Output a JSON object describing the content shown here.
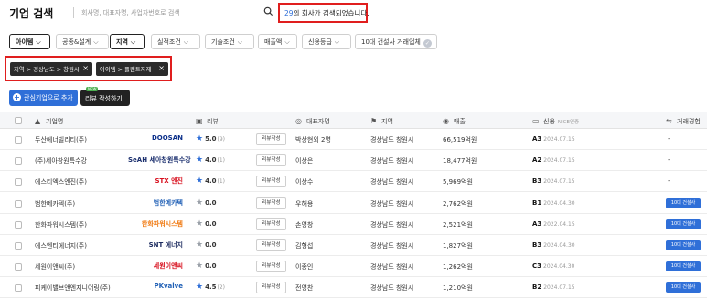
{
  "header": {
    "title": "기업 검색",
    "search_placeholder": "회사명, 대표자명, 사업자번호로 검색",
    "result_count": "29",
    "result_suffix": "의 회사가 검색되었습니다."
  },
  "filters": [
    {
      "label": "아이템",
      "active": true
    },
    {
      "label": "공종&설계",
      "active": false
    },
    {
      "label": "지역",
      "active": true
    },
    {
      "label": "실적조건",
      "active": false
    },
    {
      "label": "기술조건",
      "active": false
    },
    {
      "label": "매출액",
      "active": false
    },
    {
      "label": "신용등급",
      "active": false
    },
    {
      "label": "10대 건설사 거래업체",
      "active": false
    }
  ],
  "applied_tags": [
    {
      "label": "지역 > 경상남도 > 창원시"
    },
    {
      "label": "아이템 > 플랜트자재"
    }
  ],
  "actions": {
    "favorite_label": "관심기업으로 추가",
    "review_label": "리뷰 작성하기",
    "review_badge": "NEW"
  },
  "columns": {
    "company": "기업명",
    "review": "리뷰",
    "ceo": "대표자명",
    "region": "지역",
    "sales": "매출",
    "credit": "신용",
    "credit_sub": "NICE인증",
    "trade": "거래경험"
  },
  "rows": [
    {
      "name": "두산에너빌리티(주)",
      "logo": "DOOSAN",
      "logo_color": "#0b2f8a",
      "rating": "5.0",
      "review_count": "(9)",
      "rated": true,
      "review_btn": "리뷰작성",
      "ceo": "박상현외 2명",
      "region": "경상남도 창원시",
      "sales": "66,519억원",
      "grade": "A3",
      "grade_date": "2024.07.15",
      "trade": "-"
    },
    {
      "name": "(주)세아창원특수강",
      "logo": "SeAH 세아창원특수강",
      "logo_color": "#1b2f6e",
      "rating": "4.0",
      "review_count": "(1)",
      "rated": true,
      "review_btn": "리뷰작성",
      "ceo": "이상은",
      "region": "경상남도 창원시",
      "sales": "18,477억원",
      "grade": "A2",
      "grade_date": "2024.07.15",
      "trade": "-"
    },
    {
      "name": "에스티엑스엔진(주)",
      "logo": "STX 엔진",
      "logo_color": "#d8101e",
      "rating": "4.0",
      "review_count": "(1)",
      "rated": true,
      "review_btn": "리뷰작성",
      "ceo": "이상수",
      "region": "경상남도 창원시",
      "sales": "5,969억원",
      "grade": "B3",
      "grade_date": "2024.07.15",
      "trade": "-"
    },
    {
      "name": "범한메카텍(주)",
      "logo": "범한메카텍",
      "logo_color": "#1f5fb5",
      "rating": "0.0",
      "review_count": "",
      "rated": false,
      "review_btn": "리뷰작성",
      "ceo": "우해용",
      "region": "경상남도 창원시",
      "sales": "2,762억원",
      "grade": "B1",
      "grade_date": "2024.04.30",
      "trade": "10대 건설사"
    },
    {
      "name": "한화파워시스템(주)",
      "logo": "한화파워시스템",
      "logo_color": "#f07a12",
      "rating": "0.0",
      "review_count": "",
      "rated": false,
      "review_btn": "리뷰작성",
      "ceo": "손영창",
      "region": "경상남도 창원시",
      "sales": "2,521억원",
      "grade": "A3",
      "grade_date": "2022.04.15",
      "trade": "10대 건설사"
    },
    {
      "name": "에스엔티에너지(주)",
      "logo": "SNT 에너지",
      "logo_color": "#1b2a5e",
      "rating": "0.0",
      "review_count": "",
      "rated": false,
      "review_btn": "리뷰작성",
      "ceo": "김형섭",
      "region": "경상남도 창원시",
      "sales": "1,827억원",
      "grade": "B3",
      "grade_date": "2024.04.30",
      "trade": "10대 건설사"
    },
    {
      "name": "세원이앤씨(주)",
      "logo": "세원이앤씨",
      "logo_color": "#d8101e",
      "rating": "0.0",
      "review_count": "",
      "rated": false,
      "review_btn": "리뷰작성",
      "ceo": "이종인",
      "region": "경상남도 창원시",
      "sales": "1,262억원",
      "grade": "C3",
      "grade_date": "2024.04.30",
      "trade": "10대 건설사"
    },
    {
      "name": "피케이밸브앤엔지니어링(주)",
      "logo": "PKvalve",
      "logo_color": "#1f5fb5",
      "rating": "4.5",
      "review_count": "(2)",
      "rated": true,
      "review_btn": "리뷰작성",
      "ceo": "전영찬",
      "region": "경상남도 창원시",
      "sales": "1,210억원",
      "grade": "B2",
      "grade_date": "2024.07.15",
      "trade": "10대 건설사"
    }
  ]
}
